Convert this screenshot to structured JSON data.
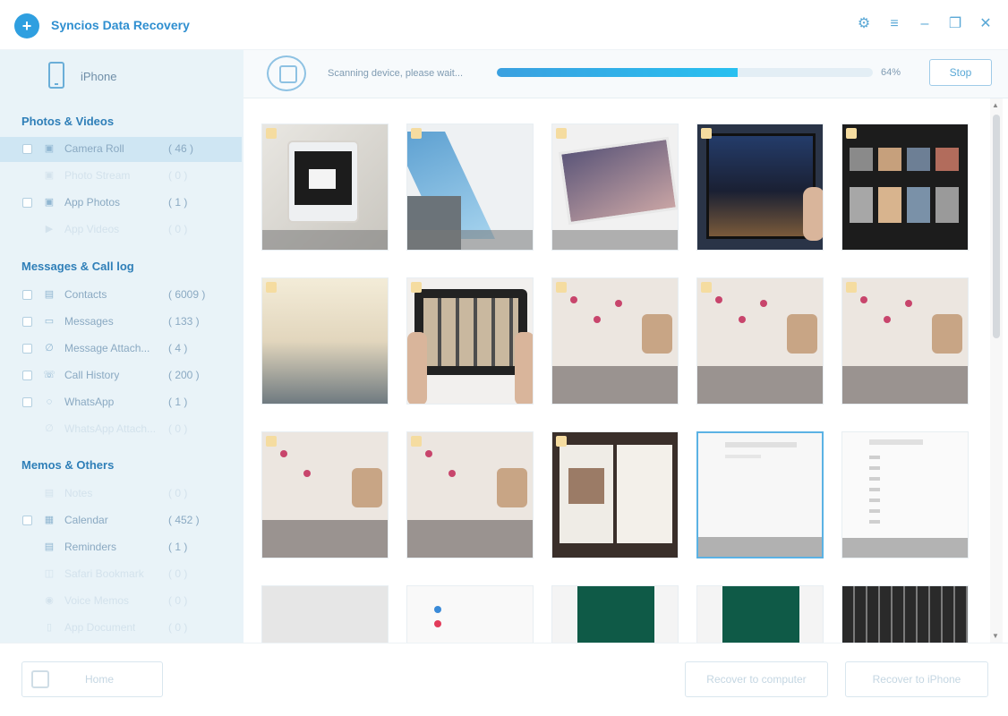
{
  "app": {
    "title": "Syncios Data Recovery"
  },
  "device": {
    "name": "iPhone"
  },
  "sidebar": {
    "sections": [
      {
        "title": "Photos & Videos"
      },
      {
        "title": "Messages & Call log"
      },
      {
        "title": "Memos & Others"
      }
    ],
    "items": [
      {
        "label": "Camera Roll",
        "count": "( 46 )"
      },
      {
        "label": "Photo Stream",
        "count": "( 0 )"
      },
      {
        "label": "App Photos",
        "count": "( 1 )"
      },
      {
        "label": "App Videos",
        "count": "( 0 )"
      },
      {
        "label": "Contacts",
        "count": "( 6009 )"
      },
      {
        "label": "Messages",
        "count": "( 133 )"
      },
      {
        "label": "Message Attach...",
        "count": "( 4 )"
      },
      {
        "label": "Call History",
        "count": "( 200 )"
      },
      {
        "label": "WhatsApp",
        "count": "( 1 )"
      },
      {
        "label": "WhatsApp Attach...",
        "count": "( 0 )"
      },
      {
        "label": "Notes",
        "count": "( 0 )"
      },
      {
        "label": "Calendar",
        "count": "( 452 )"
      },
      {
        "label": "Reminders",
        "count": "( 1 )"
      },
      {
        "label": "Safari Bookmark",
        "count": "( 0 )"
      },
      {
        "label": "Voice Memos",
        "count": "( 0 )"
      },
      {
        "label": "App Document",
        "count": "( 0 )"
      }
    ]
  },
  "scan": {
    "status": "Scanning device, please wait...",
    "percent_label": "64%",
    "progress": 0.64,
    "stop_label": "Stop"
  },
  "bottom": {
    "home_label": "Home",
    "recover_computer_label": "Recover to computer",
    "recover_iphone_label": "Recover to iPhone"
  },
  "colors": {
    "accent": "#2f9fe0",
    "sidebar_bg": "#e9f3f8",
    "progress": "#3aa0e0"
  }
}
